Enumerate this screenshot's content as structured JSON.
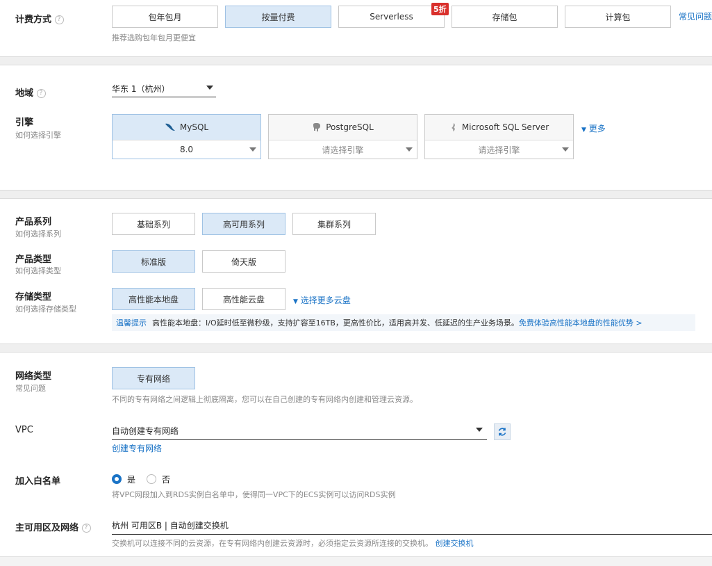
{
  "billing": {
    "label": "计费方式",
    "options": [
      "包年包月",
      "按量付费",
      "Serverless",
      "存储包",
      "计算包"
    ],
    "selected_index": 1,
    "discount_badge": "5折",
    "faq_link": "常见问题",
    "hint": "推荐选购包年包月更便宜"
  },
  "region": {
    "label": "地域",
    "value": "华东 1（杭州）"
  },
  "engine": {
    "label": "引擎",
    "sub": "如何选择引擎",
    "cards": [
      {
        "name": "MySQL",
        "version": "8.0",
        "icon": "mysql-dolphin-icon",
        "selected": true
      },
      {
        "name": "PostgreSQL",
        "version": "请选择引擎",
        "icon": "postgresql-elephant-icon",
        "selected": false
      },
      {
        "name": "Microsoft SQL Server",
        "version": "请选择引擎",
        "icon": "sqlserver-icon",
        "selected": false
      }
    ],
    "more": "更多"
  },
  "series": {
    "label": "产品系列",
    "sub": "如何选择系列",
    "options": [
      "基础系列",
      "高可用系列",
      "集群系列"
    ],
    "selected_index": 1
  },
  "type": {
    "label": "产品类型",
    "sub": "如何选择类型",
    "options": [
      "标准版",
      "倚天版"
    ],
    "selected_index": 0
  },
  "storage": {
    "label": "存储类型",
    "sub": "如何选择存储类型",
    "options": [
      "高性能本地盘",
      "高性能云盘"
    ],
    "selected_index": 0,
    "more_link": "选择更多云盘",
    "tip_tag": "温馨提示",
    "tip_text": "高性能本地盘：I/O延时低至微秒级，支持扩容至16TB，更高性价比，适用高并发、低延迟的生产业务场景。",
    "tip_link": "免费体验高性能本地盘的性能优势 >"
  },
  "network": {
    "label": "网络类型",
    "sub": "常见问题",
    "option": "专有网络",
    "hint": "不同的专有网络之间逻辑上彻底隔离，您可以在自己创建的专有网络内创建和管理云资源。"
  },
  "vpc": {
    "label": "VPC",
    "value": "自动创建专有网络",
    "create_link": "创建专有网络"
  },
  "whitelist": {
    "label": "加入白名单",
    "yes": "是",
    "no": "否",
    "hint": "将VPC网段加入到RDS实例白名单中，使得同一VPC下的ECS实例可以访问RDS实例"
  },
  "zone": {
    "label": "主可用区及网络",
    "value": "杭州 可用区B | 自动创建交换机",
    "hint": "交换机可以连接不同的云资源，在专有网络内创建云资源时，必须指定云资源所连接的交换机。",
    "link": "创建交换机"
  }
}
